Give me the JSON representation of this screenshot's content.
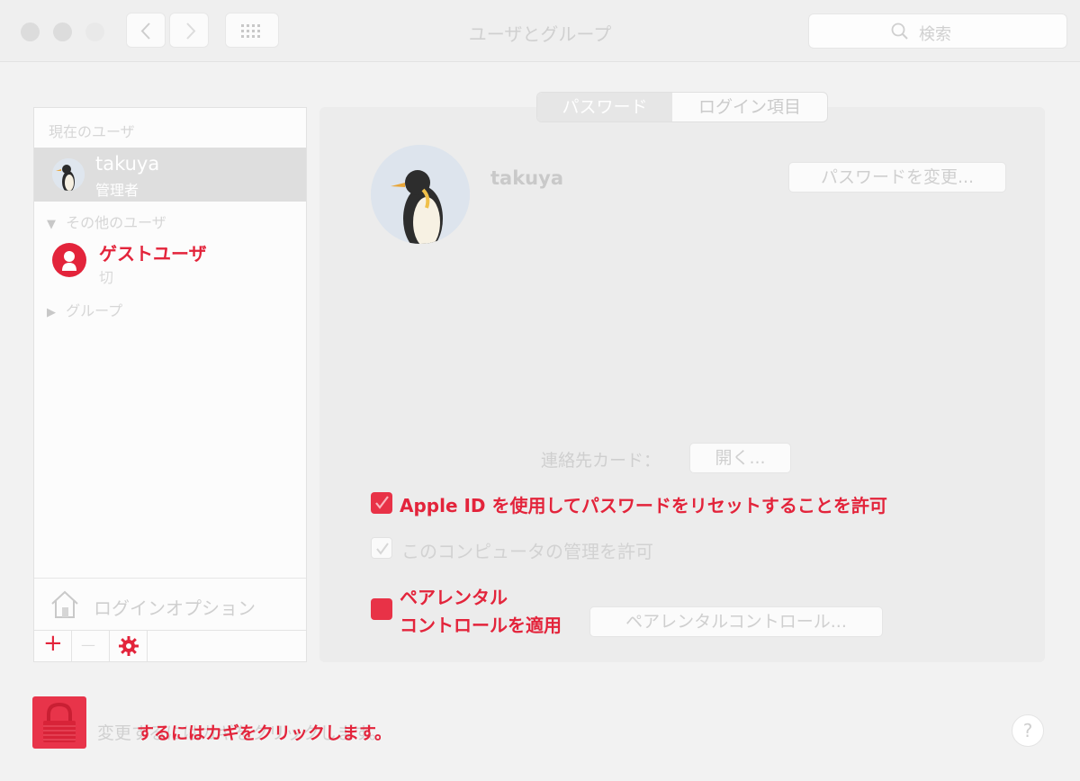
{
  "window": {
    "title": "ユーザとグループ",
    "search_placeholder": "検索"
  },
  "sidebar": {
    "current_header": "現在のユーザ",
    "current_user": {
      "name": "takuya",
      "role": "管理者"
    },
    "others_header": "その他のユーザ",
    "guest": {
      "name": "ゲストユーザ",
      "state": "切"
    },
    "groups_label": "グループ",
    "login_options": "ログインオプション",
    "add_label": "+",
    "remove_label": "—"
  },
  "tabs": [
    {
      "label": "パスワード",
      "selected": true
    },
    {
      "label": "ログイン項目",
      "selected": false
    }
  ],
  "main": {
    "user_name": "takuya",
    "change_password": "パスワードを変更...",
    "contact_card_label": "連絡先カード：",
    "open_button": "開く...",
    "apple_id_option": "Apple ID を使用してパスワードをリセットすることを許可",
    "admin_option": "このコンピュータの管理を許可",
    "parental_line1": "ペアレンタル",
    "parental_line2": "コントロールを適用",
    "parental_button": "ペアレンタルコントロール..."
  },
  "footer": {
    "lock_text": "変更するにはカギをクリックします。",
    "lock_overlay": "するにはカギをクリックします。",
    "help": "?"
  },
  "colors": {
    "accent_red": "#e3243b",
    "checkbox_red": "#e83247",
    "background": "#f2f2f2"
  }
}
